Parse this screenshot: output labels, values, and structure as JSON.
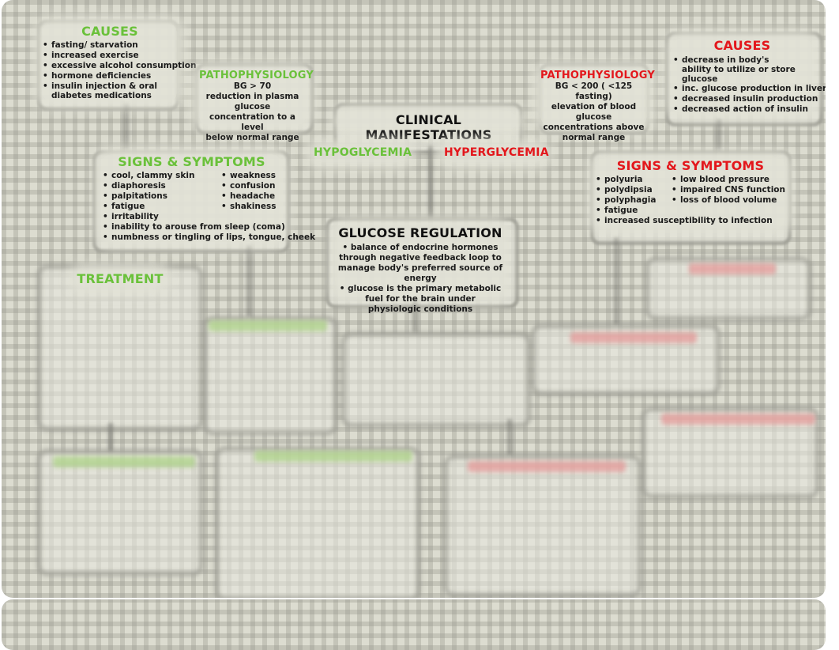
{
  "title": "CLINICAL MANIFESTATIONS",
  "branches": {
    "hypoglycemia": "HYPOGLYCEMIA",
    "hyperglycemia": "HYPERGLYCEMIA"
  },
  "hypo": {
    "causes": {
      "heading": "CAUSES",
      "items": [
        "fasting/ starvation",
        "increased exercise",
        "excessive alcohol consumption",
        "hormone deficiencies",
        "insulin injection & oral diabetes medications"
      ]
    },
    "pathophysiology": {
      "heading": "PATHOPHYSIOLOGY",
      "value": "BG > 70",
      "lines": [
        "reduction in plasma glucose",
        "concentration to a level",
        "below normal range"
      ]
    },
    "signs": {
      "heading": "SIGNS & SYMPTOMS",
      "col1": [
        "cool, clammy skin",
        "diaphoresis",
        "palpitations",
        "fatigue"
      ],
      "col2": [
        "weakness",
        "confusion",
        "headache",
        "shakiness"
      ],
      "full": [
        "irritability",
        "inability to arouse from sleep (coma)",
        "numbness or tingling of lips, tongue, cheek"
      ]
    },
    "treatment": {
      "heading": "TREATMENT"
    }
  },
  "hyper": {
    "causes": {
      "heading": "CAUSES",
      "items": [
        "decrease in body's ability to utilize or store glucose",
        "inc. glucose production in liver",
        "decreased insulin production",
        "decreased action of insulin"
      ]
    },
    "pathophysiology": {
      "heading": "PATHOPHYSIOLOGY",
      "value": "BG < 200 ( <125 fasting)",
      "lines": [
        "elevation of blood glucose",
        "concentrations above",
        "normal range"
      ]
    },
    "signs": {
      "heading": "SIGNS & SYMPTOMS",
      "col1": [
        "polyuria",
        "polydipsia",
        "polyphagia",
        "fatigue"
      ],
      "col2": [
        "low blood pressure",
        "impaired CNS function",
        "loss of blood volume"
      ],
      "full": [
        "increased susceptibility to infection"
      ]
    }
  },
  "glucose_regulation": {
    "heading": "GLUCOSE REGULATION",
    "bullets": [
      "balance of endocrine hormones through negative feedback loop to manage body's preferred source of energy",
      "glucose is the primary metabolic fuel for the brain under physiologic conditions"
    ]
  },
  "colors": {
    "hypo_accent": "#6ac13a",
    "hyper_accent": "#e3171c",
    "text": "#111111"
  }
}
